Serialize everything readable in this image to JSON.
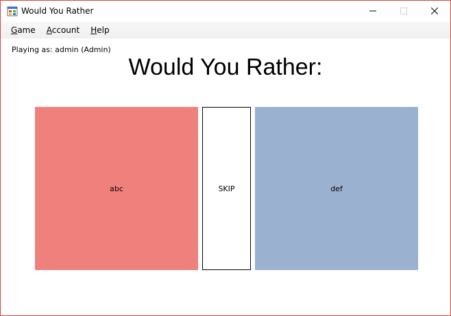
{
  "window": {
    "title": "Would You Rather",
    "icon": "app-window-icon"
  },
  "menu": {
    "items": [
      {
        "label_acc": "G",
        "label_rest": "ame"
      },
      {
        "label_acc": "A",
        "label_rest": "ccount"
      },
      {
        "label_acc": "H",
        "label_rest": "elp"
      }
    ]
  },
  "status": {
    "playing_as": "Playing as: admin (Admin)"
  },
  "main": {
    "heading": "Would You Rather:",
    "option_a": "abc",
    "skip": "SKIP",
    "option_b": "def"
  },
  "colors": {
    "option_a_bg": "#f0807c",
    "option_b_bg": "#9ab2d0",
    "window_border": "#e0413a"
  }
}
